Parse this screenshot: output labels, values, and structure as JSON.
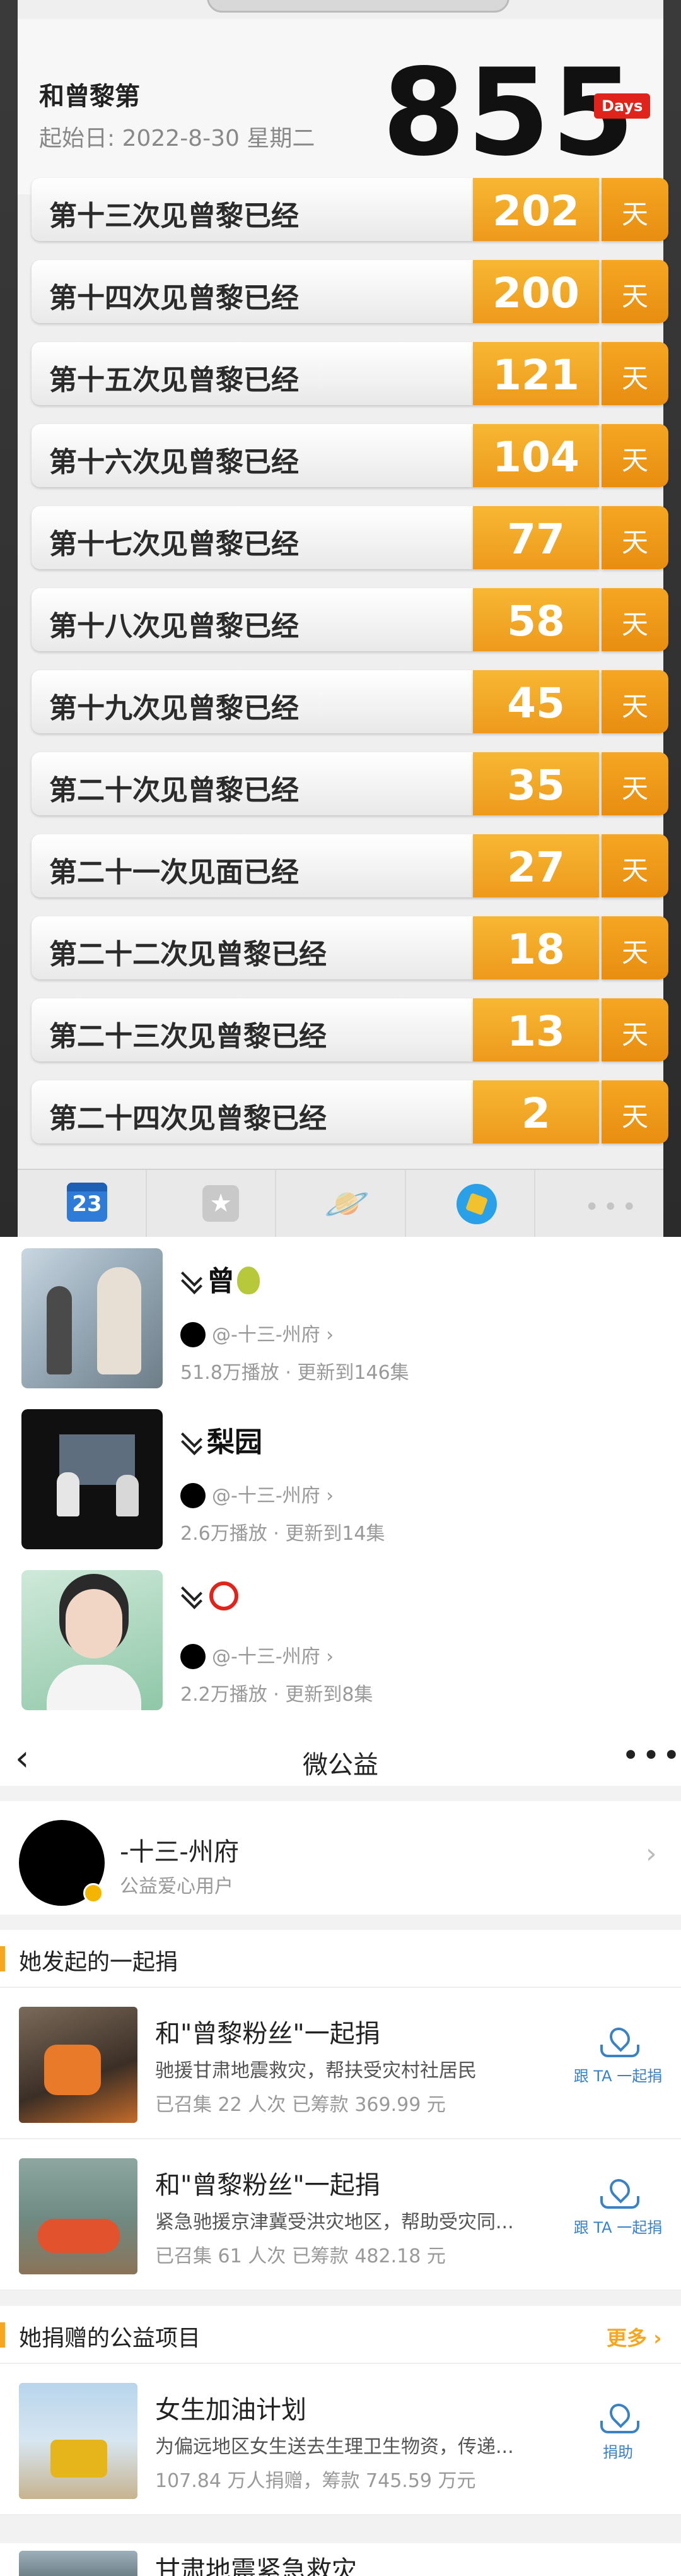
{
  "countdown": {
    "title": "和曾黎第",
    "start_date": "起始日: 2022-8-30 星期二",
    "count": "855",
    "days_badge": "Days",
    "unit": "天",
    "rows": [
      {
        "label": "第十三次见曾黎已经",
        "days": "202"
      },
      {
        "label": "第十四次见曾黎已经",
        "days": "200"
      },
      {
        "label": "第十五次见曾黎已经",
        "days": "121"
      },
      {
        "label": "第十六次见曾黎已经",
        "days": "104"
      },
      {
        "label": "第十七次见曾黎已经",
        "days": "77"
      },
      {
        "label": "第十八次见曾黎已经",
        "days": "58"
      },
      {
        "label": "第十九次见曾黎已经",
        "days": "45"
      },
      {
        "label": "第二十次见曾黎已经",
        "days": "35"
      },
      {
        "label": "第二十一次见面已经",
        "days": "27"
      },
      {
        "label": "第二十二次见曾黎已经",
        "days": "18"
      },
      {
        "label": "第二十三次见曾黎已经",
        "days": "13"
      },
      {
        "label": "第二十四次见曾黎已经",
        "days": "2"
      }
    ],
    "tabs": [
      {
        "name": "calendar-tab",
        "icon": "calendar-icon",
        "text": "23"
      },
      {
        "name": "star-tab",
        "icon": "star-icon",
        "text": "★"
      },
      {
        "name": "planet-tab",
        "icon": "planet-icon",
        "text": "🪐"
      },
      {
        "name": "badge-tab",
        "icon": "badge-icon",
        "text": ""
      },
      {
        "name": "more-tab",
        "icon": "more-icon",
        "text": "•••"
      }
    ]
  },
  "videos": [
    {
      "title": "曾",
      "title_icon": "pear-icon",
      "author": "@-十三-州府 ›",
      "meta": "51.8万播放 · 更新到146集"
    },
    {
      "title": "梨园",
      "title_icon": "",
      "author": "@-十三-州府 ›",
      "meta": "2.6万播放 · 更新到14集"
    },
    {
      "title": "",
      "title_icon": "red-circle-icon",
      "author": "@-十三-州府 ›",
      "meta": "2.2万播放 · 更新到8集"
    }
  ],
  "charity": {
    "nav": {
      "back": "‹",
      "title": "微公益",
      "more": "•••"
    },
    "user": {
      "name": "-十三-州府",
      "tag": "公益爱心用户",
      "chevron": "›"
    },
    "initiated": {
      "title": "她发起的一起捐",
      "items": [
        {
          "title": "和\"曾黎粉丝\"一起捐",
          "desc": "驰援甘肃地震救灾，帮扶受灾村社居民",
          "stats": "已召集 22 人次  已筹款 369.99 元",
          "action": "跟 TA 一起捐"
        },
        {
          "title": "和\"曾黎粉丝\"一起捐",
          "desc": "紧急驰援京津冀受洪灾地区，帮助受灾同...",
          "stats": "已召集 61 人次  已筹款 482.18 元",
          "action": "跟 TA 一起捐"
        }
      ]
    },
    "donated": {
      "title": "她捐赠的公益项目",
      "more": "更多",
      "items": [
        {
          "title": "女生加油计划",
          "desc": "为偏远地区女生送去生理卫生物资，传递...",
          "stats": "107.84 万人捐赠，筹款 745.59 万元",
          "action": "捐助"
        }
      ],
      "partial_title": "甘肃地震紧急救灾"
    }
  },
  "colors": {
    "accent": "#f5a623",
    "badge_red": "#e0241b",
    "link_blue": "#3b82c4"
  }
}
